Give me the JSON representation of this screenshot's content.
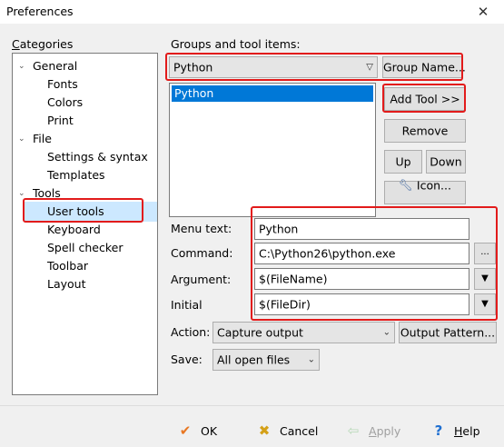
{
  "window": {
    "title": "Preferences",
    "close_glyph": "✕"
  },
  "categories": {
    "label": "Categories",
    "tree": [
      {
        "label": "General",
        "level": 0,
        "expander": "⌄"
      },
      {
        "label": "Fonts",
        "level": 1
      },
      {
        "label": "Colors",
        "level": 1
      },
      {
        "label": "Print",
        "level": 1
      },
      {
        "label": "File",
        "level": 0,
        "expander": "⌄"
      },
      {
        "label": "Settings & syntax",
        "level": 1
      },
      {
        "label": "Templates",
        "level": 1
      },
      {
        "label": "Tools",
        "level": 0,
        "expander": "⌄"
      },
      {
        "label": "User tools",
        "level": 1,
        "selected": true
      },
      {
        "label": "Keyboard",
        "level": 1
      },
      {
        "label": "Spell checker",
        "level": 1
      },
      {
        "label": "Toolbar",
        "level": 1
      },
      {
        "label": "Layout",
        "level": 1
      }
    ]
  },
  "groups": {
    "label": "Groups and tool items:",
    "group_select_value": "Python",
    "group_name_button": "Group Name...",
    "list_items": [
      "Python"
    ],
    "add_tool_button": "Add Tool >>",
    "remove_button": "Remove",
    "up_button": "Up",
    "down_button": "Down",
    "icon_button": "Icon..."
  },
  "form": {
    "menu_text_label": "Menu text:",
    "menu_text_value": "Python",
    "command_label": "Command:",
    "command_value": "C:\\Python26\\python.exe",
    "command_browse": "...",
    "argument_label": "Argument:",
    "argument_value": "$(FileName)",
    "initial_label": "Initial",
    "initial_value": "$(FileDir)",
    "action_label": "Action:",
    "action_value": "Capture output",
    "output_pattern_button": "Output Pattern...",
    "save_label": "Save:",
    "save_value": "All open files"
  },
  "footer": {
    "ok": "OK",
    "cancel": "Cancel",
    "apply": "Apply",
    "help": "Help"
  },
  "colors": {
    "highlight": "#e21b1b",
    "selection": "#0078d7",
    "ok_check": "#e87722",
    "cancel_x": "#d4a017",
    "help_q": "#1f6fd1"
  }
}
